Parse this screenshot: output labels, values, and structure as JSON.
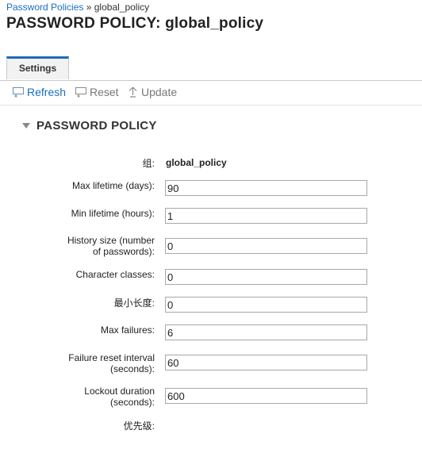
{
  "breadcrumb": {
    "parent": "Password Policies",
    "separator": "»",
    "current": "global_policy"
  },
  "header": {
    "title_prefix": "PASSWORD POLICY:",
    "title_name": "global_policy"
  },
  "tabs": [
    {
      "label": "Settings"
    }
  ],
  "toolbar": {
    "refresh": "Refresh",
    "reset": "Reset",
    "update": "Update"
  },
  "section": {
    "title": "PASSWORD POLICY"
  },
  "form": {
    "group_label": "组:",
    "group_value": "global_policy",
    "max_lifetime_label": "Max lifetime (days):",
    "max_lifetime": "90",
    "min_lifetime_label": "Min lifetime (hours):",
    "min_lifetime": "1",
    "history_size_label_1": "History size (number",
    "history_size_label_2": "of passwords):",
    "history_size": "0",
    "char_classes_label": "Character classes:",
    "char_classes": "0",
    "min_length_label": "最小长度:",
    "min_length": "0",
    "max_failures_label": "Max failures:",
    "max_failures": "6",
    "failure_reset_label_1": "Failure reset interval",
    "failure_reset_label_2": "(seconds):",
    "failure_reset": "60",
    "lockout_label_1": "Lockout duration",
    "lockout_label_2": "(seconds):",
    "lockout": "600",
    "priority_label": "优先级:"
  },
  "colors": {
    "link": "#1a6fc0",
    "tab_accent": "#1e6bb3"
  }
}
